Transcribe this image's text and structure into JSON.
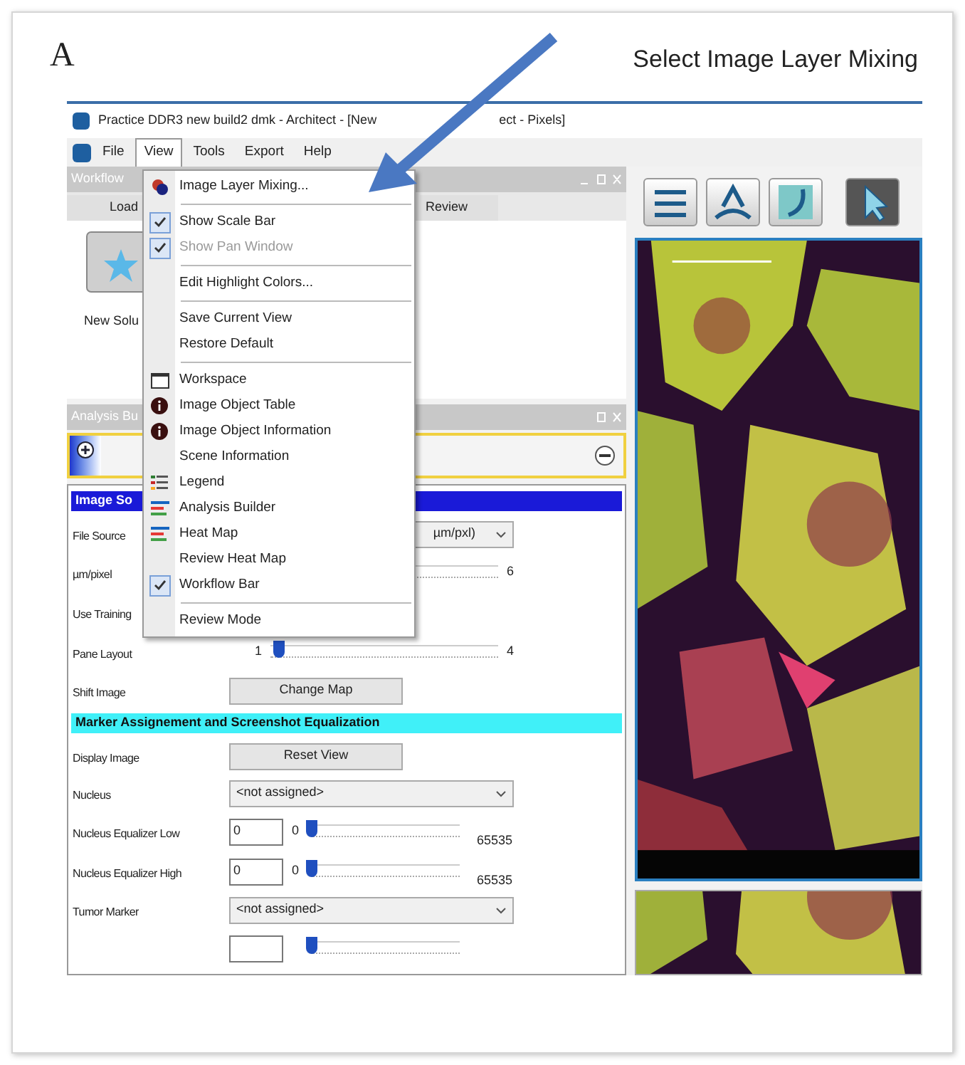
{
  "figure": {
    "label": "A",
    "caption": "Select Image Layer Mixing"
  },
  "window": {
    "title": "Practice DDR3 new build2 dmk - Architect - [New",
    "title_tail": "ect - Pixels]"
  },
  "menubar": [
    {
      "label": "File",
      "selected": false
    },
    {
      "label": "View",
      "selected": true
    },
    {
      "label": "Tools",
      "selected": false
    },
    {
      "label": "Export",
      "selected": false
    },
    {
      "label": "Help",
      "selected": false
    }
  ],
  "workflow_panel": {
    "title": "Workflow",
    "tabs": [
      {
        "label": "Load",
        "selected": false
      },
      {
        "label": "Review",
        "selected": false
      }
    ],
    "tool_label": "New Solu"
  },
  "analysis_panel": {
    "title": "Analysis Bu",
    "rows": [
      {
        "kind": "header",
        "text": "Image So",
        "color": "#1a1ad8"
      },
      {
        "kind": "covered_dropdown",
        "label": "File Source",
        "value": "µm/pxl)"
      },
      {
        "kind": "slider",
        "label": "µm/pixel",
        "max": "6"
      },
      {
        "kind": "label",
        "label": "Use Training"
      },
      {
        "kind": "slider",
        "label": "Pane Layout",
        "min": "1",
        "max": "4",
        "level": 0.04
      },
      {
        "kind": "button",
        "label": "Shift Image",
        "button": "Change Map"
      },
      {
        "kind": "header",
        "text": "Marker Assignement and Screenshot Equalization",
        "color": "#40f0f8"
      },
      {
        "kind": "button",
        "label": "Display Image",
        "button": "Reset View"
      },
      {
        "kind": "dropdown",
        "label": "Nucleus",
        "value": "<not assigned>"
      },
      {
        "kind": "equalizer",
        "label": "Nucleus Equalizer Low",
        "value": "0",
        "min": "0",
        "max": "65535",
        "level": 0
      },
      {
        "kind": "equalizer",
        "label": "Nucleus Equalizer High",
        "value": "0",
        "min": "0",
        "max": "65535",
        "level": 0
      },
      {
        "kind": "dropdown",
        "label": "Tumor Marker",
        "value": "<not assigned>"
      },
      {
        "kind": "equalizer",
        "level": 0
      }
    ]
  },
  "view_menu": {
    "groups": [
      [
        {
          "label": "Image Layer Mixing...",
          "kind": "layers",
          "checked": false,
          "disabled": false
        }
      ],
      [
        {
          "label": "Show Scale Bar",
          "kind": "none",
          "checked": true,
          "disabled": false
        },
        {
          "label": "Show Pan Window",
          "kind": "none",
          "checked": true,
          "disabled": true
        }
      ],
      [
        {
          "label": "Edit Highlight Colors...",
          "kind": "none",
          "checked": false,
          "disabled": false
        }
      ],
      [
        {
          "label": "Save Current View",
          "kind": "none",
          "checked": false,
          "disabled": false
        },
        {
          "label": "Restore Default",
          "kind": "none",
          "checked": false,
          "disabled": false
        }
      ],
      [
        {
          "label": "Workspace",
          "kind": "window",
          "checked": false,
          "disabled": false
        },
        {
          "label": "Image Object Table",
          "kind": "info",
          "checked": false,
          "disabled": false
        },
        {
          "label": "Image Object Information",
          "kind": "info",
          "checked": false,
          "disabled": false
        },
        {
          "label": "Scene Information",
          "kind": "none",
          "checked": false,
          "disabled": false
        },
        {
          "label": "Legend",
          "kind": "legend",
          "checked": false,
          "disabled": false
        },
        {
          "label": "Analysis Builder",
          "kind": "list",
          "checked": false,
          "disabled": false
        },
        {
          "label": "Heat Map",
          "kind": "list",
          "checked": false,
          "disabled": false
        },
        {
          "label": "Review Heat Map",
          "kind": "none",
          "checked": false,
          "disabled": false
        },
        {
          "label": "Workflow  Bar",
          "kind": "none",
          "checked": true,
          "disabled": false
        }
      ],
      [
        {
          "label": "Review Mode",
          "kind": "none",
          "checked": false,
          "disabled": false
        }
      ]
    ]
  }
}
